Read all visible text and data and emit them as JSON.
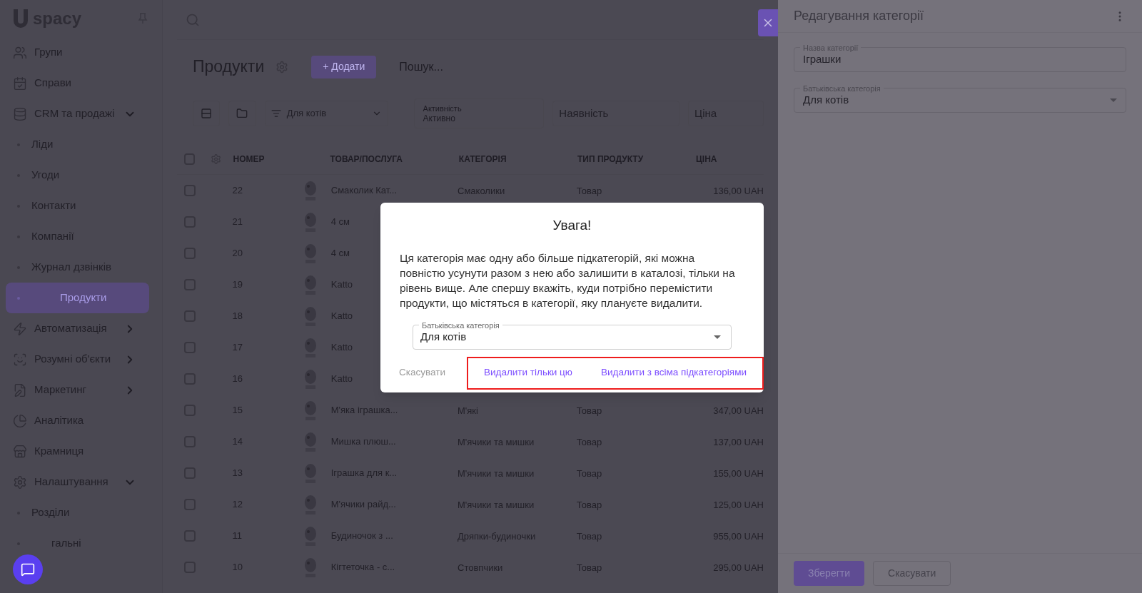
{
  "sidebar": {
    "logo": "spacy",
    "items": [
      {
        "label": "Групи",
        "kind": "section",
        "selected": false
      },
      {
        "label": "Справи",
        "kind": "section",
        "selected": false
      },
      {
        "label": "CRM та продажі",
        "kind": "section",
        "expanded": true,
        "selected": false
      },
      {
        "label": "Ліди",
        "kind": "sub",
        "selected": false
      },
      {
        "label": "Угоди",
        "kind": "sub",
        "selected": false
      },
      {
        "label": "Контакти",
        "kind": "sub",
        "selected": false
      },
      {
        "label": "Компанії",
        "kind": "sub",
        "selected": false
      },
      {
        "label": "Журнал дзвінків",
        "kind": "sub",
        "selected": false
      },
      {
        "label": "Продукти",
        "kind": "sub",
        "selected": true
      },
      {
        "label": "Автоматизація",
        "kind": "section",
        "expanded": false,
        "selected": false
      },
      {
        "label": "Розумні об'єкти",
        "kind": "section",
        "expanded": false,
        "selected": false
      },
      {
        "label": "Маркетинг",
        "kind": "section",
        "expanded": false,
        "selected": false
      },
      {
        "label": "Аналітика",
        "kind": "section",
        "selected": false
      },
      {
        "label": "Крамниця",
        "kind": "section",
        "selected": false
      },
      {
        "label": "Налаштування",
        "kind": "section",
        "expanded": true,
        "selected": false
      },
      {
        "label": "Розділи",
        "kind": "sub",
        "selected": false
      },
      {
        "label": "гальні",
        "kind": "sub",
        "selected": false
      }
    ]
  },
  "page": {
    "title": "Продукти",
    "add_button": "+ Додати",
    "search": {
      "placeholder": "Пошук..."
    },
    "filters": {
      "category": "Для котів",
      "activity": {
        "label": "Активність",
        "value": "Активно"
      },
      "availability": "Наявність",
      "price": "Ціна"
    }
  },
  "table": {
    "all_checked": false,
    "columns": [
      "НОМЕР",
      "ТОВАР/ПОСЛУГА",
      "КАТЕГОРІЯ",
      "ТИП ПРОДУКТУ",
      "ЦІНА"
    ],
    "rows": [
      {
        "checked": false,
        "number": "22",
        "name": "Смаколик Кат...",
        "category": "Смаколики",
        "type": "Товар",
        "price": "136,00 UAH"
      },
      {
        "checked": false,
        "number": "21",
        "name": "4 см"
      },
      {
        "checked": false,
        "number": "20",
        "name": "4 см"
      },
      {
        "checked": false,
        "number": "19",
        "name": "Katto"
      },
      {
        "checked": false,
        "number": "18",
        "name": "Katto"
      },
      {
        "checked": false,
        "number": "17",
        "name": "Katto"
      },
      {
        "checked": false,
        "number": "16",
        "name": "Katto"
      },
      {
        "checked": false,
        "number": "15",
        "name": "М'яка іграшка...",
        "category": "М'які",
        "type": "Товар",
        "price": "347,00 UAH"
      },
      {
        "checked": false,
        "number": "14",
        "name": "Мишка плюш...",
        "category": "М'ячики та мишки",
        "type": "Товар",
        "price": "137,00 UAH"
      },
      {
        "checked": false,
        "number": "13",
        "name": "Іграшка для к...",
        "category": "М'ячики та мишки",
        "type": "Товар",
        "price": "155,00 UAH"
      },
      {
        "checked": false,
        "number": "12",
        "name": "М'ячики райд...",
        "category": "М'ячики та мишки",
        "type": "Товар",
        "price": "125,00 UAH"
      },
      {
        "checked": false,
        "number": "11",
        "name": "Будиночок з ...",
        "category": "Дряпки-будиночки",
        "type": "Товар",
        "price": "955,00 UAH"
      },
      {
        "checked": false,
        "number": "10",
        "name": "Кігтеточка - с...",
        "category": "Стовпчики",
        "type": "Товар",
        "price": "295,00 UAH"
      }
    ]
  },
  "panel": {
    "title": "Редагування категорії",
    "name_field": {
      "label": "Назва категорії",
      "value": "Іграшки"
    },
    "parent_field": {
      "label": "Батьківська категорія",
      "value": "Для котів"
    },
    "buttons": [
      "Зберегти",
      "Скасувати"
    ]
  },
  "dialog": {
    "title": "Увага!",
    "message": "Ця категорія має одну або більше підкатегорій, які можна повністю усунути разом з нею або залишити в каталозі, тільки на рівень вище. Але спершу вкажіть, куди потрібно перемістити продукти, що містяться в категорії, яку плануєте видалити.",
    "parent_field": {
      "label": "Батьківська категорія",
      "value": "Для котів"
    },
    "cancel": "Скасувати",
    "actions": [
      "Видалити тільки цю",
      "Видалити з всіма підкатегоріями"
    ]
  }
}
